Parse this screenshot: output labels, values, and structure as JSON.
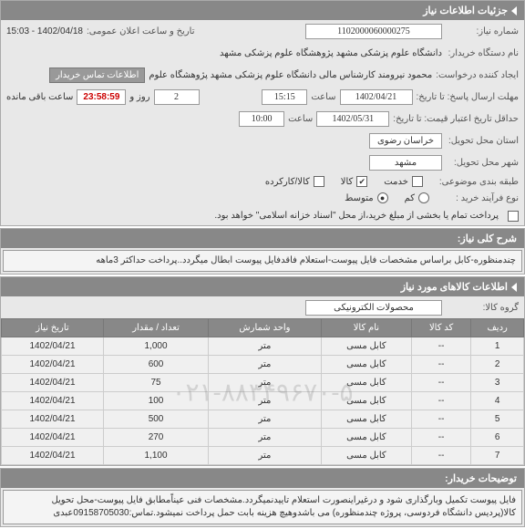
{
  "sections": {
    "need_info": "جزئیات اطلاعات نیاز",
    "general_desc": "شرح کلی نیاز:",
    "items_info": "اطلاعات کالاهای مورد نیاز",
    "buyer_notes": "توضیحات خریدار:"
  },
  "form": {
    "need_number_label": "شماره نیاز:",
    "need_number": "1102000060000275",
    "announce_datetime_label": "تاریخ و ساعت اعلان عمومی:",
    "announce_datetime": "1402/04/18 - 15:03",
    "buyer_org_label": "نام دستگاه خریدار:",
    "buyer_org": "دانشگاه علوم پزشکی مشهد   پژوهشگاه علوم پزشکی مشهد",
    "requester_label": "ایجاد کننده درخواست:",
    "requester": "محمود نیرومند کارشناس مالی دانشگاه علوم پزشکی مشهد   پژوهشگاه علوم",
    "contact_btn": "اطلاعات تماس خریدار",
    "deadline_label": "مهلت ارسال پاسخ: تا تاریخ:",
    "deadline_date": "1402/04/21",
    "time_label": "ساعت",
    "deadline_time": "15:15",
    "days_remaining": "2",
    "days_and_label": "روز و",
    "countdown": "23:58:59",
    "remaining_label": "ساعت باقی مانده",
    "valid_until_label": "حداقل تاریخ اعتبار قیمت: تا تاریخ:",
    "valid_until_date": "1402/05/31",
    "valid_until_time": "10:00",
    "province_label": "استان محل تحویل:",
    "province": "خراسان رضوی",
    "city_label": "شهر محل تحویل:",
    "city": "مشهد",
    "subject_class_label": "طبقه بندی موضوعی:",
    "class_service": "خدمت",
    "class_goods": "کالا",
    "class_used": "کالا/کارکرده",
    "buy_type_label": "نوع فرآیند خرید :",
    "buy_low": "کم",
    "buy_mid": "متوسط",
    "payment_note": "پرداخت تمام یا بخشی از مبلغ خرید،از محل \"اسناد خزانه اسلامی\" خواهد بود."
  },
  "general_description": "چندمنظوره-کابل براساس مشخصات فایل پیوست-استعلام فاقدفایل پیوست ابطال میگردد..پرداخت حداکثر 3ماهه",
  "goods_group_label": "گروه کالا:",
  "goods_group": "محصولات الکترونیکی",
  "table": {
    "headers": {
      "row": "ردیف",
      "item_code": "کد کالا",
      "item_name": "نام کالا",
      "order_unit": "واحد شمارش",
      "qty": "تعداد / مقدار",
      "need_date": "تاریخ نیاز"
    },
    "rows": [
      {
        "row": "1",
        "code": "--",
        "name": "کابل مسی",
        "unit": "متر",
        "qty": "1,000",
        "date": "1402/04/21"
      },
      {
        "row": "2",
        "code": "--",
        "name": "کابل مسی",
        "unit": "متر",
        "qty": "600",
        "date": "1402/04/21"
      },
      {
        "row": "3",
        "code": "--",
        "name": "کابل مسی",
        "unit": "متر",
        "qty": "75",
        "date": "1402/04/21"
      },
      {
        "row": "4",
        "code": "--",
        "name": "کابل مسی",
        "unit": "متر",
        "qty": "100",
        "date": "1402/04/21"
      },
      {
        "row": "5",
        "code": "--",
        "name": "کابل مسی",
        "unit": "متر",
        "qty": "500",
        "date": "1402/04/21"
      },
      {
        "row": "6",
        "code": "--",
        "name": "کابل مسی",
        "unit": "متر",
        "qty": "270",
        "date": "1402/04/21"
      },
      {
        "row": "7",
        "code": "--",
        "name": "کابل مسی",
        "unit": "متر",
        "qty": "1,100",
        "date": "1402/04/21"
      }
    ]
  },
  "watermark": "۰۲۱-۸۸۳۴۹۶۷۰-۵",
  "buyer_notes": "فایل پیوست تکمیل وبارگذاری شود و درغیراینصورت استعلام تاییدنمیگردد.مشخصات فنی عیناًمطابق فایل پیوست-محل تحویل کالا(پردیس دانشگاه فردوسی، پروژه چندمنظوره) می باشدوهیچ هزینه بابت حمل پرداخت نمیشود.تماس:09158705030عبدی"
}
